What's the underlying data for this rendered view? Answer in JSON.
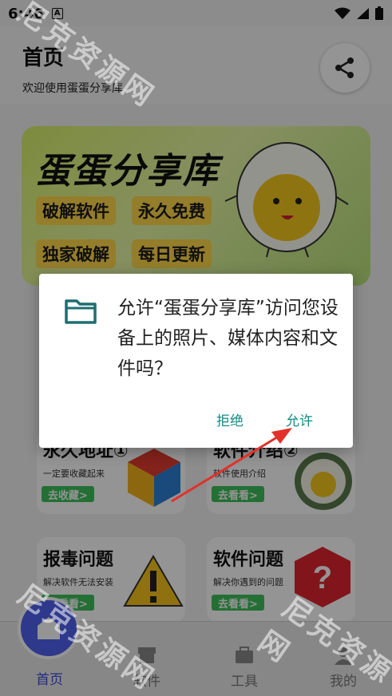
{
  "status_bar": {
    "time": "6:46",
    "notification_icon": "A"
  },
  "header": {
    "title": "首页",
    "subtitle": "欢迎使用蛋蛋分享库",
    "share_icon": "share-icon"
  },
  "banner": {
    "title": "蛋蛋分享库",
    "tags": [
      "破解软件",
      "永久免费",
      "独家破解",
      "每日更新"
    ]
  },
  "cards": [
    {
      "title": "永久地址①",
      "desc": "一定要收藏起来",
      "button": "去收藏>"
    },
    {
      "title": "软件介绍②",
      "desc": "软件使用介绍",
      "button": "去看看>"
    },
    {
      "title": "报毒问题",
      "desc": "解决软件无法安装",
      "button": "去看看>"
    },
    {
      "title": "软件问题",
      "desc": "解决你遇到的问题",
      "button": "去看看>"
    }
  ],
  "nav": {
    "items": [
      "首页",
      "软件",
      "工具",
      "我的"
    ],
    "active": 0
  },
  "dialog": {
    "message": "允许“蛋蛋分享库”访问您设备上的照片、媒体内容和文件吗？",
    "deny_label": "拒绝",
    "allow_label": "允许"
  },
  "watermark": "尼克资源网",
  "colors": {
    "accent": "#138a83",
    "nav_active": "#3a4ce0",
    "banner_tag": "#ffd84a",
    "card_button": "#3fbf5a"
  }
}
